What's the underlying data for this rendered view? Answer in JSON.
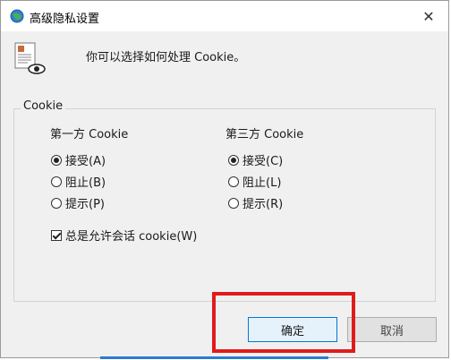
{
  "dialog": {
    "title": "高级隐私设置",
    "close_glyph": "✕",
    "intro_text": "你可以选择如何处理 Cookie。"
  },
  "cookie_group": {
    "label": "Cookie",
    "first_party": {
      "title": "第一方 Cookie",
      "options": [
        {
          "label": "接受(A)",
          "selected": true
        },
        {
          "label": "阻止(B)",
          "selected": false
        },
        {
          "label": "提示(P)",
          "selected": false
        }
      ]
    },
    "third_party": {
      "title": "第三方 Cookie",
      "options": [
        {
          "label": "接受(C)",
          "selected": true
        },
        {
          "label": "阻止(L)",
          "selected": false
        },
        {
          "label": "提示(R)",
          "selected": false
        }
      ]
    },
    "session_checkbox": {
      "label": "总是允许会话 cookie(W)",
      "checked": true
    }
  },
  "buttons": {
    "ok_label": "确定",
    "cancel_label": "取消"
  },
  "colors": {
    "highlight": "#e01b1b",
    "accent": "#0078d7"
  }
}
